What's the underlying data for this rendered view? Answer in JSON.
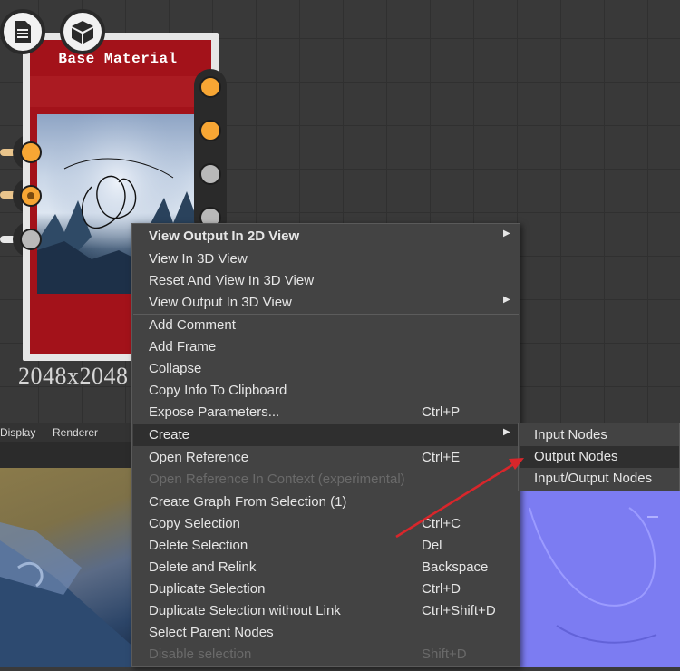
{
  "node": {
    "title": "Base Material",
    "dimension": "2048x2048",
    "icons": [
      "document-icon",
      "cube-icon"
    ]
  },
  "view3d": {
    "tabs": [
      "Display",
      "Renderer"
    ]
  },
  "context_menu": {
    "items": [
      {
        "label": "View Output In 2D View",
        "shortcut": "",
        "submenu": true,
        "bold": true
      },
      {
        "label": "View In 3D View",
        "shortcut": ""
      },
      {
        "label": "Reset And View In 3D View",
        "shortcut": ""
      },
      {
        "label": "View Output In 3D View",
        "shortcut": "",
        "submenu": true
      },
      {
        "label": "Add Comment",
        "shortcut": ""
      },
      {
        "label": "Add Frame",
        "shortcut": ""
      },
      {
        "label": "Collapse",
        "shortcut": ""
      },
      {
        "label": "Copy Info To Clipboard",
        "shortcut": ""
      },
      {
        "label": "Expose Parameters...",
        "shortcut": "Ctrl+P"
      },
      {
        "label": "Create",
        "shortcut": "",
        "submenu": true,
        "highlighted": true
      },
      {
        "label": "Open Reference",
        "shortcut": "Ctrl+E"
      },
      {
        "label": "Open Reference In Context (experimental)",
        "shortcut": "",
        "disabled": true
      },
      {
        "label": "Create Graph From Selection (1)",
        "shortcut": ""
      },
      {
        "label": "Copy Selection",
        "shortcut": "Ctrl+C"
      },
      {
        "label": "Delete Selection",
        "shortcut": "Del"
      },
      {
        "label": "Delete and Relink",
        "shortcut": "Backspace"
      },
      {
        "label": "Duplicate Selection",
        "shortcut": "Ctrl+D"
      },
      {
        "label": "Duplicate Selection without Link",
        "shortcut": "Ctrl+Shift+D"
      },
      {
        "label": "Select Parent Nodes",
        "shortcut": ""
      },
      {
        "label": "Disable selection",
        "shortcut": "Shift+D",
        "disabled": true
      }
    ]
  },
  "create_submenu": {
    "items": [
      {
        "label": "Input Nodes"
      },
      {
        "label": "Output Nodes",
        "highlighted": true
      },
      {
        "label": "Input/Output Nodes"
      }
    ]
  },
  "colors": {
    "annotation_arrow": "#d8262b",
    "socket_orange": "#f7a634",
    "node_red": "#a3121a",
    "normal_map": "#7c7cf2"
  }
}
